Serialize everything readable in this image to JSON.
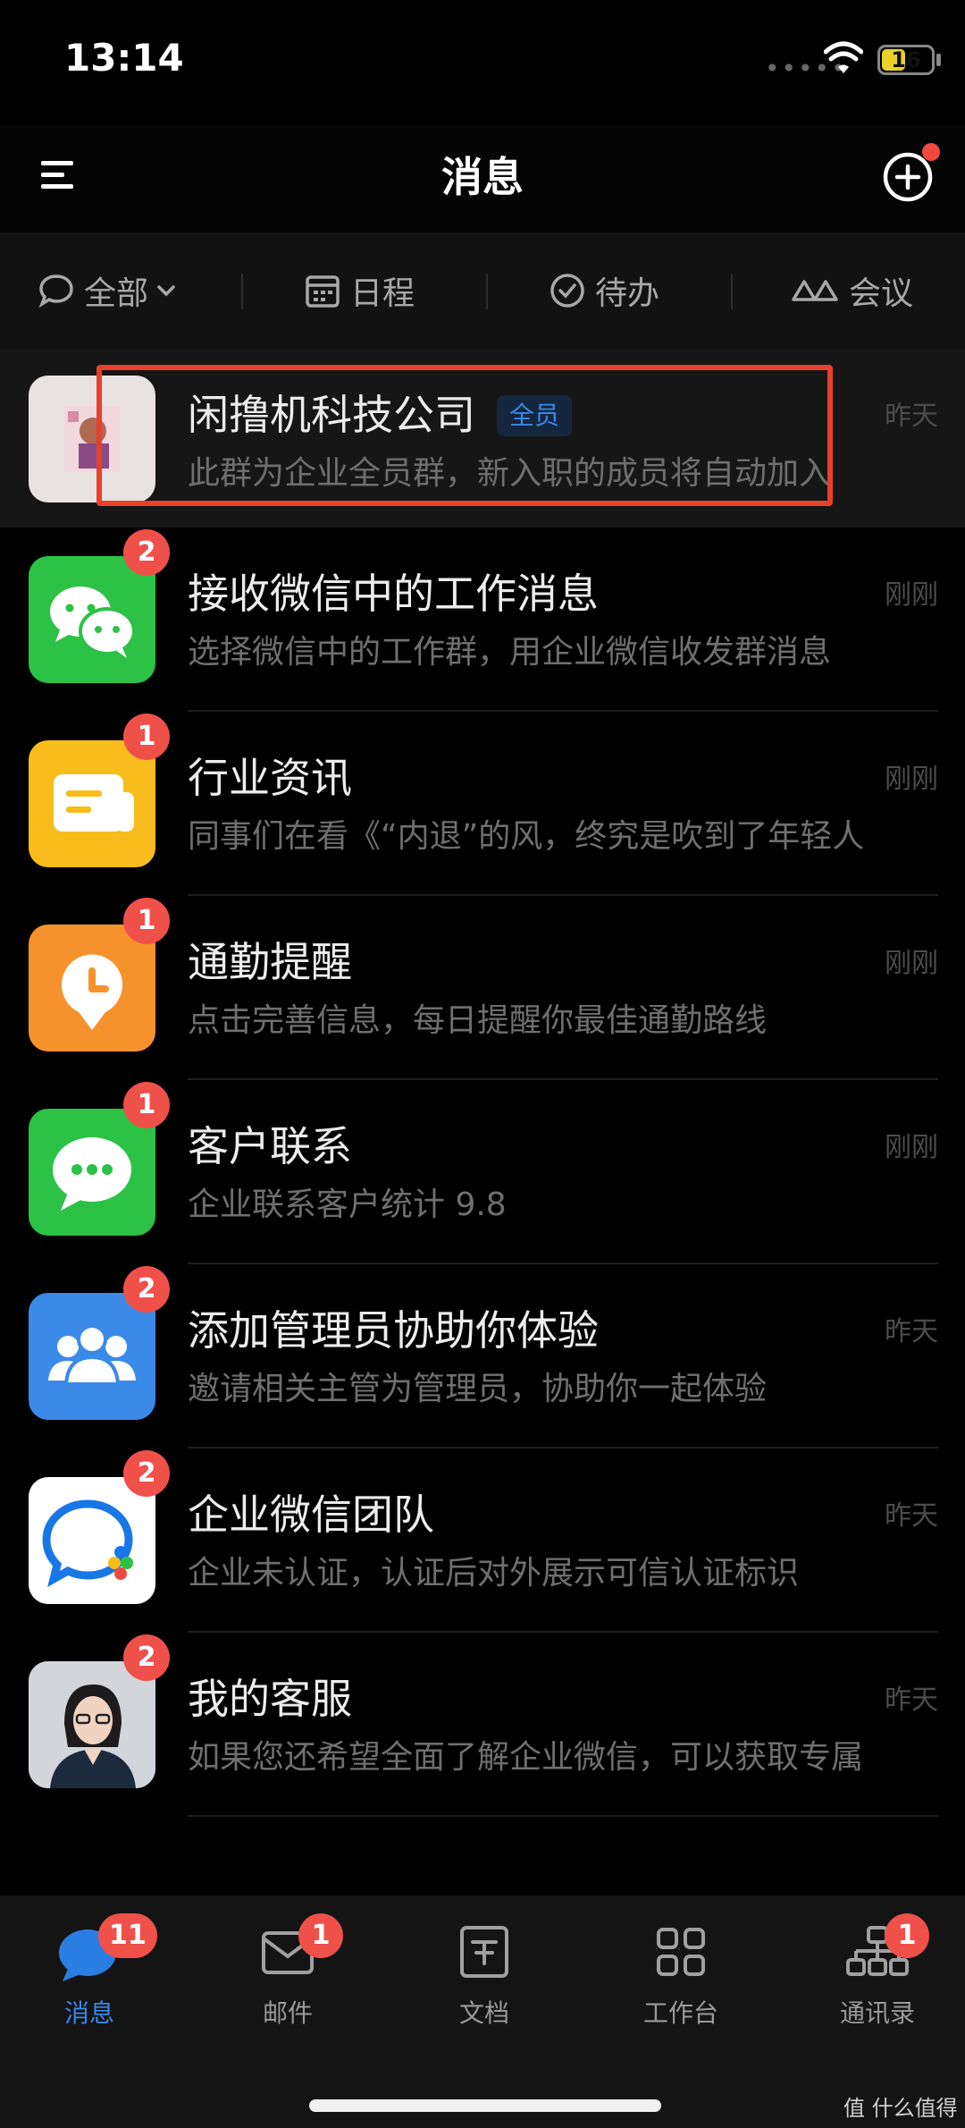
{
  "status_bar": {
    "time": "13:14",
    "battery": "16",
    "signal_dots": "•••••"
  },
  "header": {
    "title": "消息"
  },
  "filters": [
    {
      "label": "全部",
      "icon": "chat-bubble-icon"
    },
    {
      "label": "日程",
      "icon": "calendar-icon"
    },
    {
      "label": "待办",
      "icon": "check-circle-icon"
    },
    {
      "label": "会议",
      "icon": "meeting-icon"
    }
  ],
  "messages": [
    {
      "title": "闲撸机科技公司",
      "tag": "全员",
      "preview": "此群为企业全员群，新入职的成员将自动加入",
      "time": "昨天",
      "badge": ""
    },
    {
      "title": "接收微信中的工作消息",
      "preview": "选择微信中的工作群，用企业微信收发群消息",
      "time": "刚刚",
      "badge": "2"
    },
    {
      "title": "行业资讯",
      "preview": "同事们在看《“内退”的风，终究是吹到了年轻人",
      "time": "刚刚",
      "badge": "1"
    },
    {
      "title": "通勤提醒",
      "preview": "点击完善信息，每日提醒你最佳通勤路线",
      "time": "刚刚",
      "badge": "1"
    },
    {
      "title": "客户联系",
      "preview": "企业联系客户统计 9.8",
      "time": "刚刚",
      "badge": "1"
    },
    {
      "title": "添加管理员协助你体验",
      "preview": "邀请相关主管为管理员，协助你一起体验",
      "time": "昨天",
      "badge": "2"
    },
    {
      "title": "企业微信团队",
      "preview": "企业未认证，认证后对外展示可信认证标识",
      "time": "昨天",
      "badge": "2"
    },
    {
      "title": "我的客服",
      "preview": "如果您还希望全面了解企业微信，可以获取专属",
      "time": "昨天",
      "badge": "2"
    }
  ],
  "tabs": [
    {
      "label": "消息",
      "badge": "11"
    },
    {
      "label": "邮件",
      "badge": "1"
    },
    {
      "label": "文档",
      "badge": ""
    },
    {
      "label": "工作台",
      "badge": ""
    },
    {
      "label": "通讯录",
      "badge": "1"
    }
  ],
  "watermark": "值 什么值得买",
  "colors": {
    "accent": "#3a88e8",
    "badge": "#f0504a",
    "highlight": "#e8402b",
    "wechat_green": "#2bc246",
    "yellow": "#f8bd1c",
    "orange": "#f6922c",
    "blue": "#3b8ae8"
  }
}
